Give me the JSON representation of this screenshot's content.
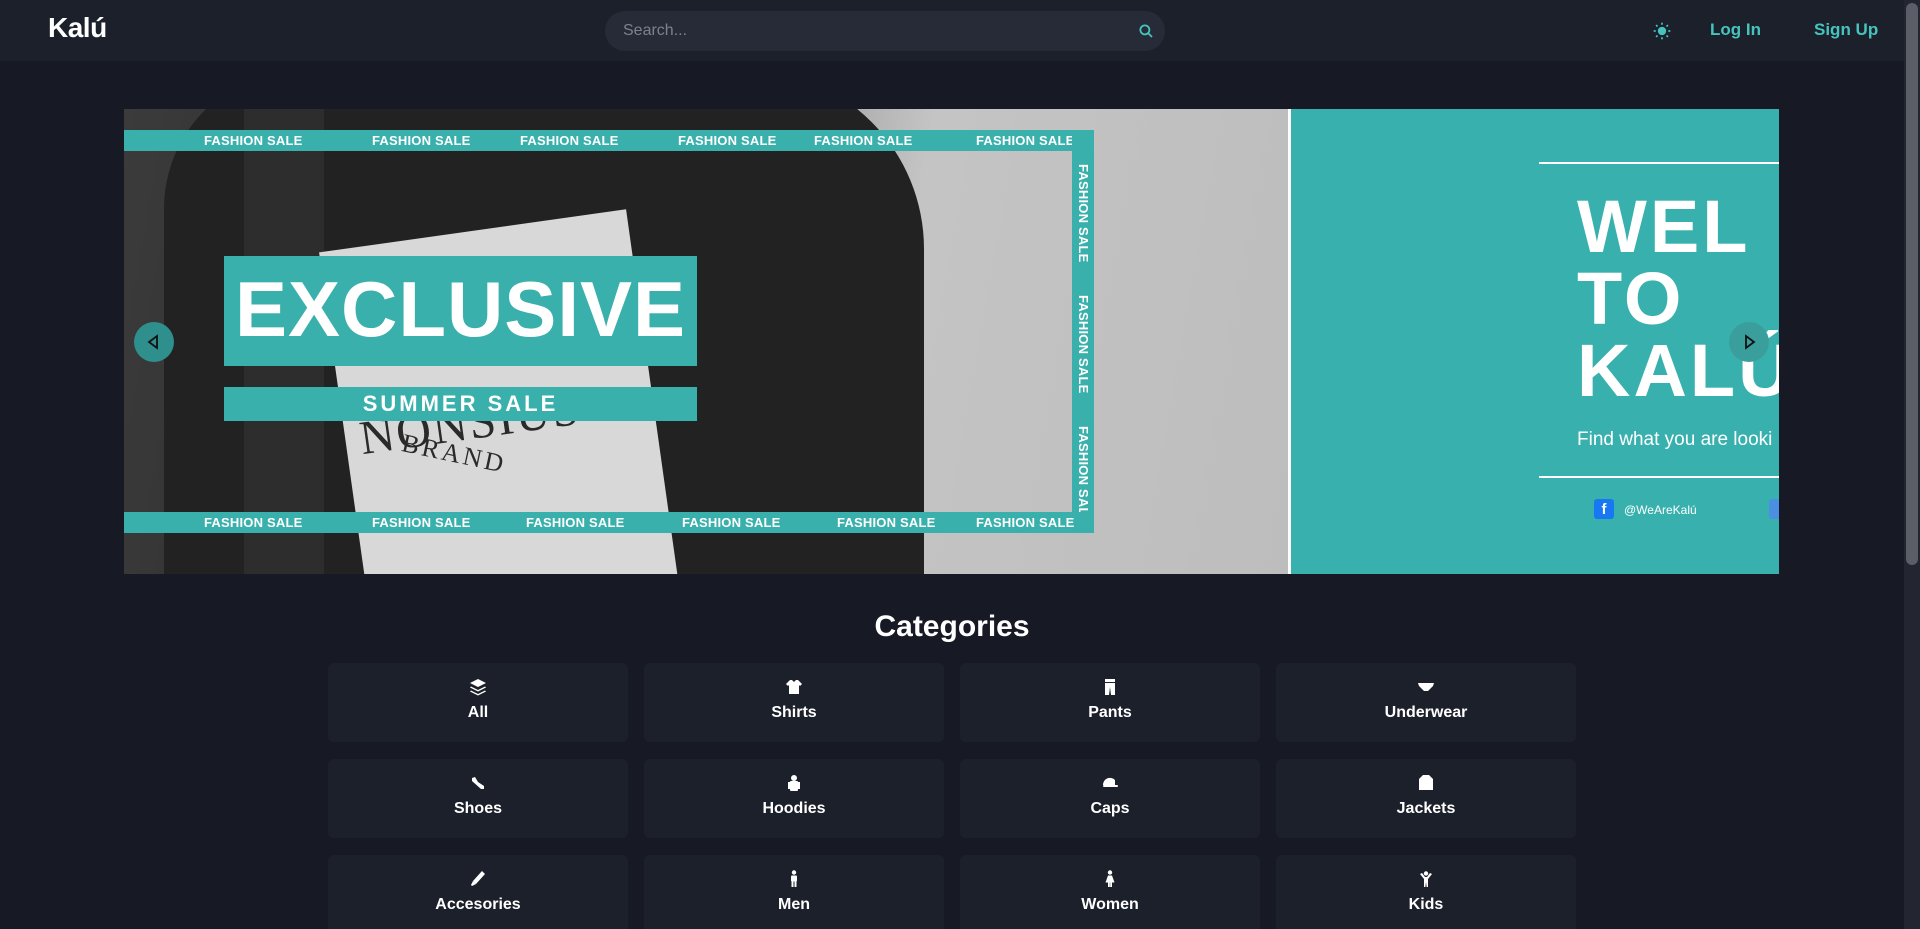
{
  "header": {
    "logo": "Kalú",
    "search_placeholder": "Search...",
    "login_label": "Log In",
    "signup_label": "Sign Up",
    "icons": {
      "search": "search-icon",
      "theme": "sun-icon"
    }
  },
  "hero": {
    "strip_text": "FASHION SALE",
    "headline": "EXCLUSIVE",
    "subheadline": "SUMMER SALE",
    "garment_brand": "NONSIUS",
    "garment_brand_sub": "BRAND",
    "welcome_title": "WEL\nTO\nKALÚ",
    "welcome_subtitle": "Find what you are looki",
    "facebook_handle": "@WeAreKalú",
    "accent_color": "#3ab0ac"
  },
  "categories": {
    "title": "Categories",
    "items": [
      {
        "label": "All",
        "icon": "layers-icon"
      },
      {
        "label": "Shirts",
        "icon": "shirt-icon"
      },
      {
        "label": "Pants",
        "icon": "pants-icon"
      },
      {
        "label": "Underwear",
        "icon": "underwear-icon"
      },
      {
        "label": "Shoes",
        "icon": "shoe-icon"
      },
      {
        "label": "Hoodies",
        "icon": "hoodie-icon"
      },
      {
        "label": "Caps",
        "icon": "cap-icon"
      },
      {
        "label": "Jackets",
        "icon": "jacket-icon"
      },
      {
        "label": "Accesories",
        "icon": "accessory-icon"
      },
      {
        "label": "Men",
        "icon": "man-icon"
      },
      {
        "label": "Women",
        "icon": "woman-icon"
      },
      {
        "label": "Kids",
        "icon": "child-icon"
      }
    ]
  }
}
